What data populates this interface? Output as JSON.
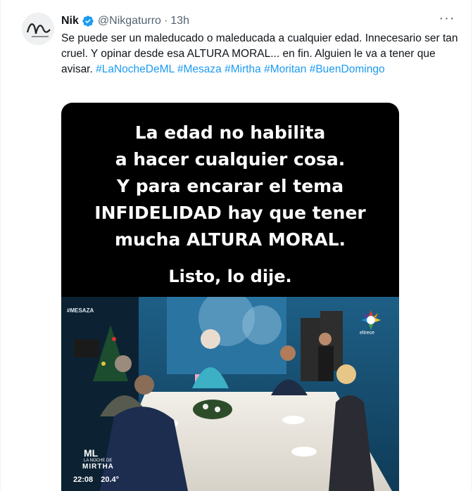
{
  "author": {
    "name": "Nik",
    "handle": "@Nikgaturro",
    "time": "13h",
    "dot": "·"
  },
  "tweet": {
    "text": "Se puede ser un maleducado o maleducada a cualquier edad. Innecesario ser tan cruel. Y opinar desde esa ALTURA MORAL... en fin. Alguien le va a tener que avisar.",
    "hashtags": [
      "#LaNocheDeML",
      "#Mesaza",
      "#Mirtha",
      "#Moritan",
      "#BuenDomingo"
    ]
  },
  "media": {
    "overlay_lines": [
      "La edad no habilita",
      "a hacer cualquier cosa.",
      "Y para encarar el tema",
      "INFIDELIDAD hay que tener",
      "mucha ALTURA MORAL."
    ],
    "overlay_final": "Listo, lo dije.",
    "tv_tag": "#MESAZA",
    "channel": "eltrece",
    "show_badge": {
      "ml": "ML",
      "sub": "LA NOCHE DE",
      "title": "MIRTHA"
    },
    "clock": "22:08",
    "temperature": "20.4°"
  },
  "icons": {
    "verified": "verified-badge-icon",
    "more": "more-icon"
  },
  "colors": {
    "link": "#1d9bf0",
    "verified": "#1d9bf0",
    "text": "#0f1419",
    "muted": "#536471"
  }
}
